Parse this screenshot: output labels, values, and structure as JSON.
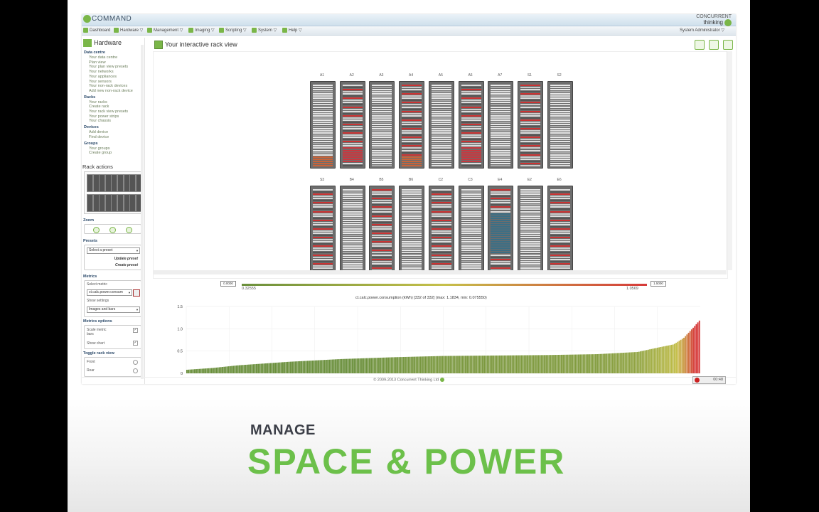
{
  "app": {
    "logo": "COMMAND",
    "brand_top": "CONCURRENT",
    "brand_bottom": "thinking"
  },
  "menu": [
    {
      "label": "Dashboard",
      "icon": "dashboard-icon"
    },
    {
      "label": "Hardware ▽",
      "icon": "hardware-icon"
    },
    {
      "label": "Management ▽",
      "icon": "management-icon"
    },
    {
      "label": "Imaging ▽",
      "icon": "imaging-icon"
    },
    {
      "label": "Scripting ▽",
      "icon": "scripting-icon"
    },
    {
      "label": "System ▽",
      "icon": "system-icon"
    },
    {
      "label": "Help ▽",
      "icon": "help-icon"
    }
  ],
  "user": "System Administrator ▽",
  "sidebar": {
    "title": "Hardware",
    "sections": [
      {
        "title": "Data centre",
        "items": [
          "Your data centre",
          "Plan view",
          "Your plan view presets",
          "Your networks",
          "Your appliances",
          "Your sensors",
          "Your non-rack devices",
          "Add new non-rack device"
        ]
      },
      {
        "title": "Racks",
        "items": [
          "Your racks",
          "Create rack",
          "Your rack view presets",
          "Your power strips",
          "Your chassis"
        ]
      },
      {
        "title": "Devices",
        "items": [
          "Add device",
          "Find device"
        ]
      },
      {
        "title": "Groups",
        "items": [
          "Your groups",
          "Create group"
        ]
      }
    ],
    "rack_actions": "Rack actions",
    "zoom": "Zoom",
    "presets": {
      "title": "Presets",
      "select": "Select a preset",
      "update": "Update preset",
      "create": "Create preset"
    },
    "metrics": {
      "title": "Metrics",
      "select_label": "Select metric",
      "select_value": "ct.calc.power.consum",
      "show_label": "Show settings",
      "show_value": "Images and bars"
    },
    "metrics_options": {
      "title": "Metrics options",
      "scale_label": "Scale metric bars",
      "chart_label": "Show chart",
      "scale_checked": "✓",
      "chart_checked": "✓"
    },
    "toggle": {
      "title": "Toggle rack view",
      "front": "Front",
      "rear": "Rear"
    }
  },
  "main": {
    "title": "Your interactive rack view"
  },
  "racks": {
    "row1": [
      "A1",
      "A2",
      "A3",
      "A4",
      "A5",
      "A6",
      "A7",
      "S1",
      "S2"
    ],
    "row2": [
      "S3",
      "B4",
      "B5",
      "B6",
      "C2",
      "C3",
      "E4",
      "E2",
      "E6"
    ]
  },
  "scale": {
    "min_box": "0.0000",
    "min": "0.32555",
    "max": "1.0569",
    "max_box": "1.5000"
  },
  "chart_title": "ct.calc.power.consumption (kWh) [332 of 332] (max: 1.1834, min: 0.075550)",
  "chart_data": {
    "type": "bar",
    "title": "ct.calc.power.consumption (kWh) [332 of 332] (max: 1.1834, min: 0.075550)",
    "ylim": [
      0,
      1.5
    ],
    "yticks": [
      "1.5",
      "1.0",
      "0.5",
      "0"
    ],
    "count": 332,
    "min": 0.07555,
    "max": 1.1834,
    "profile": [
      [
        0,
        0.08
      ],
      [
        0.05,
        0.12
      ],
      [
        0.1,
        0.18
      ],
      [
        0.2,
        0.26
      ],
      [
        0.3,
        0.32
      ],
      [
        0.4,
        0.36
      ],
      [
        0.5,
        0.39
      ],
      [
        0.6,
        0.4
      ],
      [
        0.7,
        0.41
      ],
      [
        0.8,
        0.43
      ],
      [
        0.88,
        0.48
      ],
      [
        0.92,
        0.58
      ],
      [
        0.95,
        0.65
      ],
      [
        0.97,
        0.8
      ],
      [
        0.99,
        1.05
      ],
      [
        1,
        1.1834
      ]
    ]
  },
  "footer": "© 2009-2013 Concurrent Thinking Ltd",
  "clock": "00:48",
  "caption": {
    "line1": "MANAGE",
    "line2": "SPACE & POWER"
  }
}
